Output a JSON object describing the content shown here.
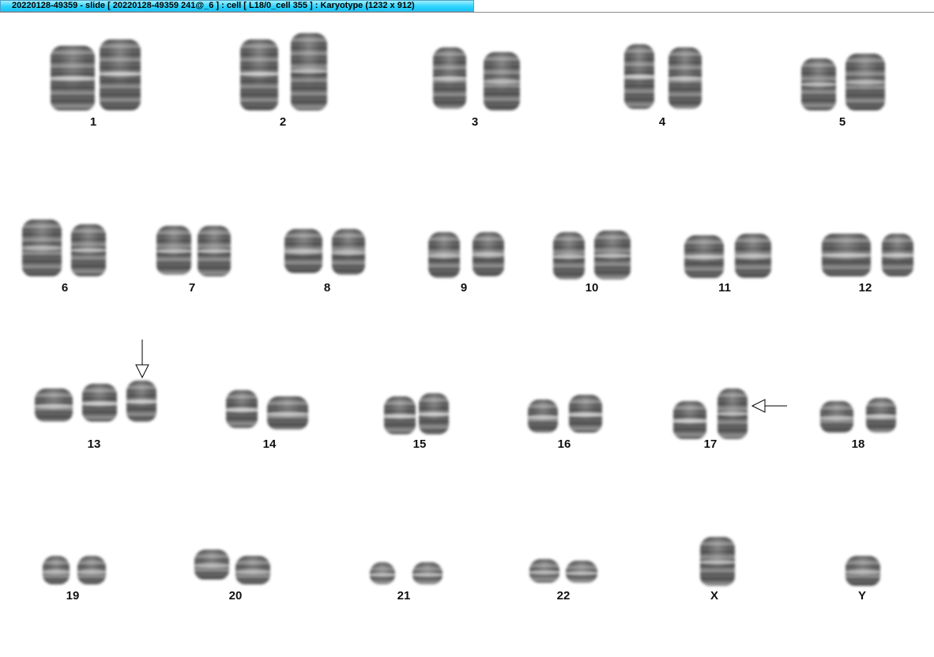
{
  "window": {
    "title": "20220128-49359 - slide [ 20220128-49359 241@_6 ] : cell [ L18/0_cell 355 ] : Karyotype  (1232 x 912)",
    "titlebar_color": "#2fd4ff"
  },
  "karyotype": {
    "labels": [
      "1",
      "2",
      "3",
      "4",
      "5",
      "6",
      "7",
      "8",
      "9",
      "10",
      "11",
      "12",
      "13",
      "14",
      "15",
      "16",
      "17",
      "18",
      "19",
      "20",
      "21",
      "22",
      "X",
      "Y"
    ],
    "annotations": [
      {
        "chromosome": "13",
        "icon": "arrow-down-icon"
      },
      {
        "chromosome": "17",
        "icon": "arrow-left-icon"
      }
    ]
  }
}
